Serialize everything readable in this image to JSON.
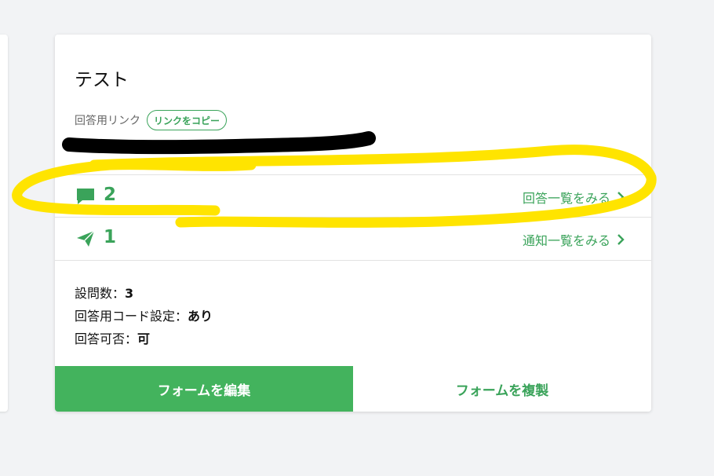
{
  "form_card": {
    "title": "テスト",
    "link_label": "回答用リンク",
    "copy_link_button": "リンクをコピー",
    "link_url_visible": "",
    "responses": {
      "count": "2",
      "link_text": "回答一覧をみる"
    },
    "notifications": {
      "count": "1",
      "link_text": "通知一覧をみる"
    },
    "meta": {
      "questions_label": "設問数：",
      "questions_value": "3",
      "code_label": "回答用コード設定：",
      "code_value": "あり",
      "accept_label": "回答可否：",
      "accept_value": "可"
    },
    "edit_button": "フォームを編集",
    "duplicate_button": "フォームを複製"
  },
  "colors": {
    "accent": "#3aa35a",
    "button_green": "#43b35d",
    "annotation_yellow": "#ffe400",
    "redaction_black": "#000000"
  },
  "icons": {
    "responses": "chat-bubble-icon",
    "notifications": "paper-plane-icon",
    "chevron": "chevron-right-icon"
  }
}
